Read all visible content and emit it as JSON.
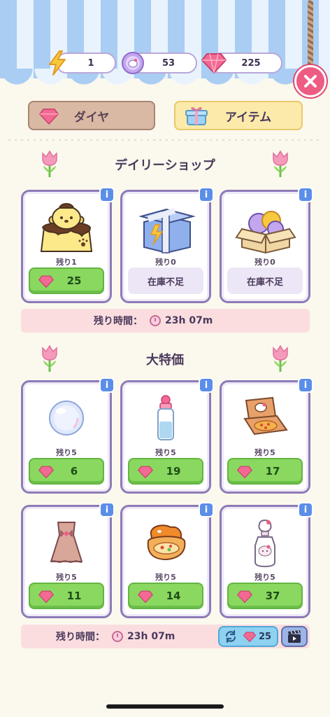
{
  "currencies": [
    {
      "name": "lightning-energy",
      "icon": "lightning-icon",
      "value": "1"
    },
    {
      "name": "hello-kitty-coin",
      "icon": "coin-icon",
      "value": "53"
    },
    {
      "name": "diamond",
      "icon": "gem-icon",
      "value": "225"
    }
  ],
  "tabs": [
    {
      "label": "ダイヤ",
      "selected": false
    },
    {
      "label": "アイテム",
      "selected": true
    }
  ],
  "daily_shop": {
    "title": "デイリーショップ",
    "items": [
      {
        "icon": "pompompurin-pudding-icon",
        "remaining": "残り1",
        "price": "25",
        "sold_out": false
      },
      {
        "icon": "blue-gift-box-icon",
        "remaining": "残り0",
        "status": "在庫不足",
        "sold_out": true
      },
      {
        "icon": "coin-box-icon",
        "remaining": "残り0",
        "status": "在庫不足",
        "sold_out": true
      }
    ],
    "timer_label": "残り時間：",
    "timer_value": "23h 07m"
  },
  "special_offers": {
    "title": "大特価",
    "items": [
      {
        "icon": "bubble-icon",
        "remaining": "残り5",
        "price": "6"
      },
      {
        "icon": "milk-bottle-icon",
        "remaining": "残り5",
        "price": "19"
      },
      {
        "icon": "pizza-box-icon",
        "remaining": "残り5",
        "price": "17"
      },
      {
        "icon": "pink-dress-icon",
        "remaining": "残り5",
        "price": "11"
      },
      {
        "icon": "bread-icon",
        "remaining": "残り5",
        "price": "14"
      },
      {
        "icon": "hello-kitty-bottle-icon",
        "remaining": "残り5",
        "price": "37"
      }
    ],
    "timer_label": "残り時間：",
    "timer_value": "23h 07m",
    "refresh_price": "25"
  },
  "colors": {
    "accent_pink": "#ee5b83",
    "price_green": "#8ad85f",
    "card_border": "#8d7bb7",
    "info_blue": "#5b8ee9"
  }
}
